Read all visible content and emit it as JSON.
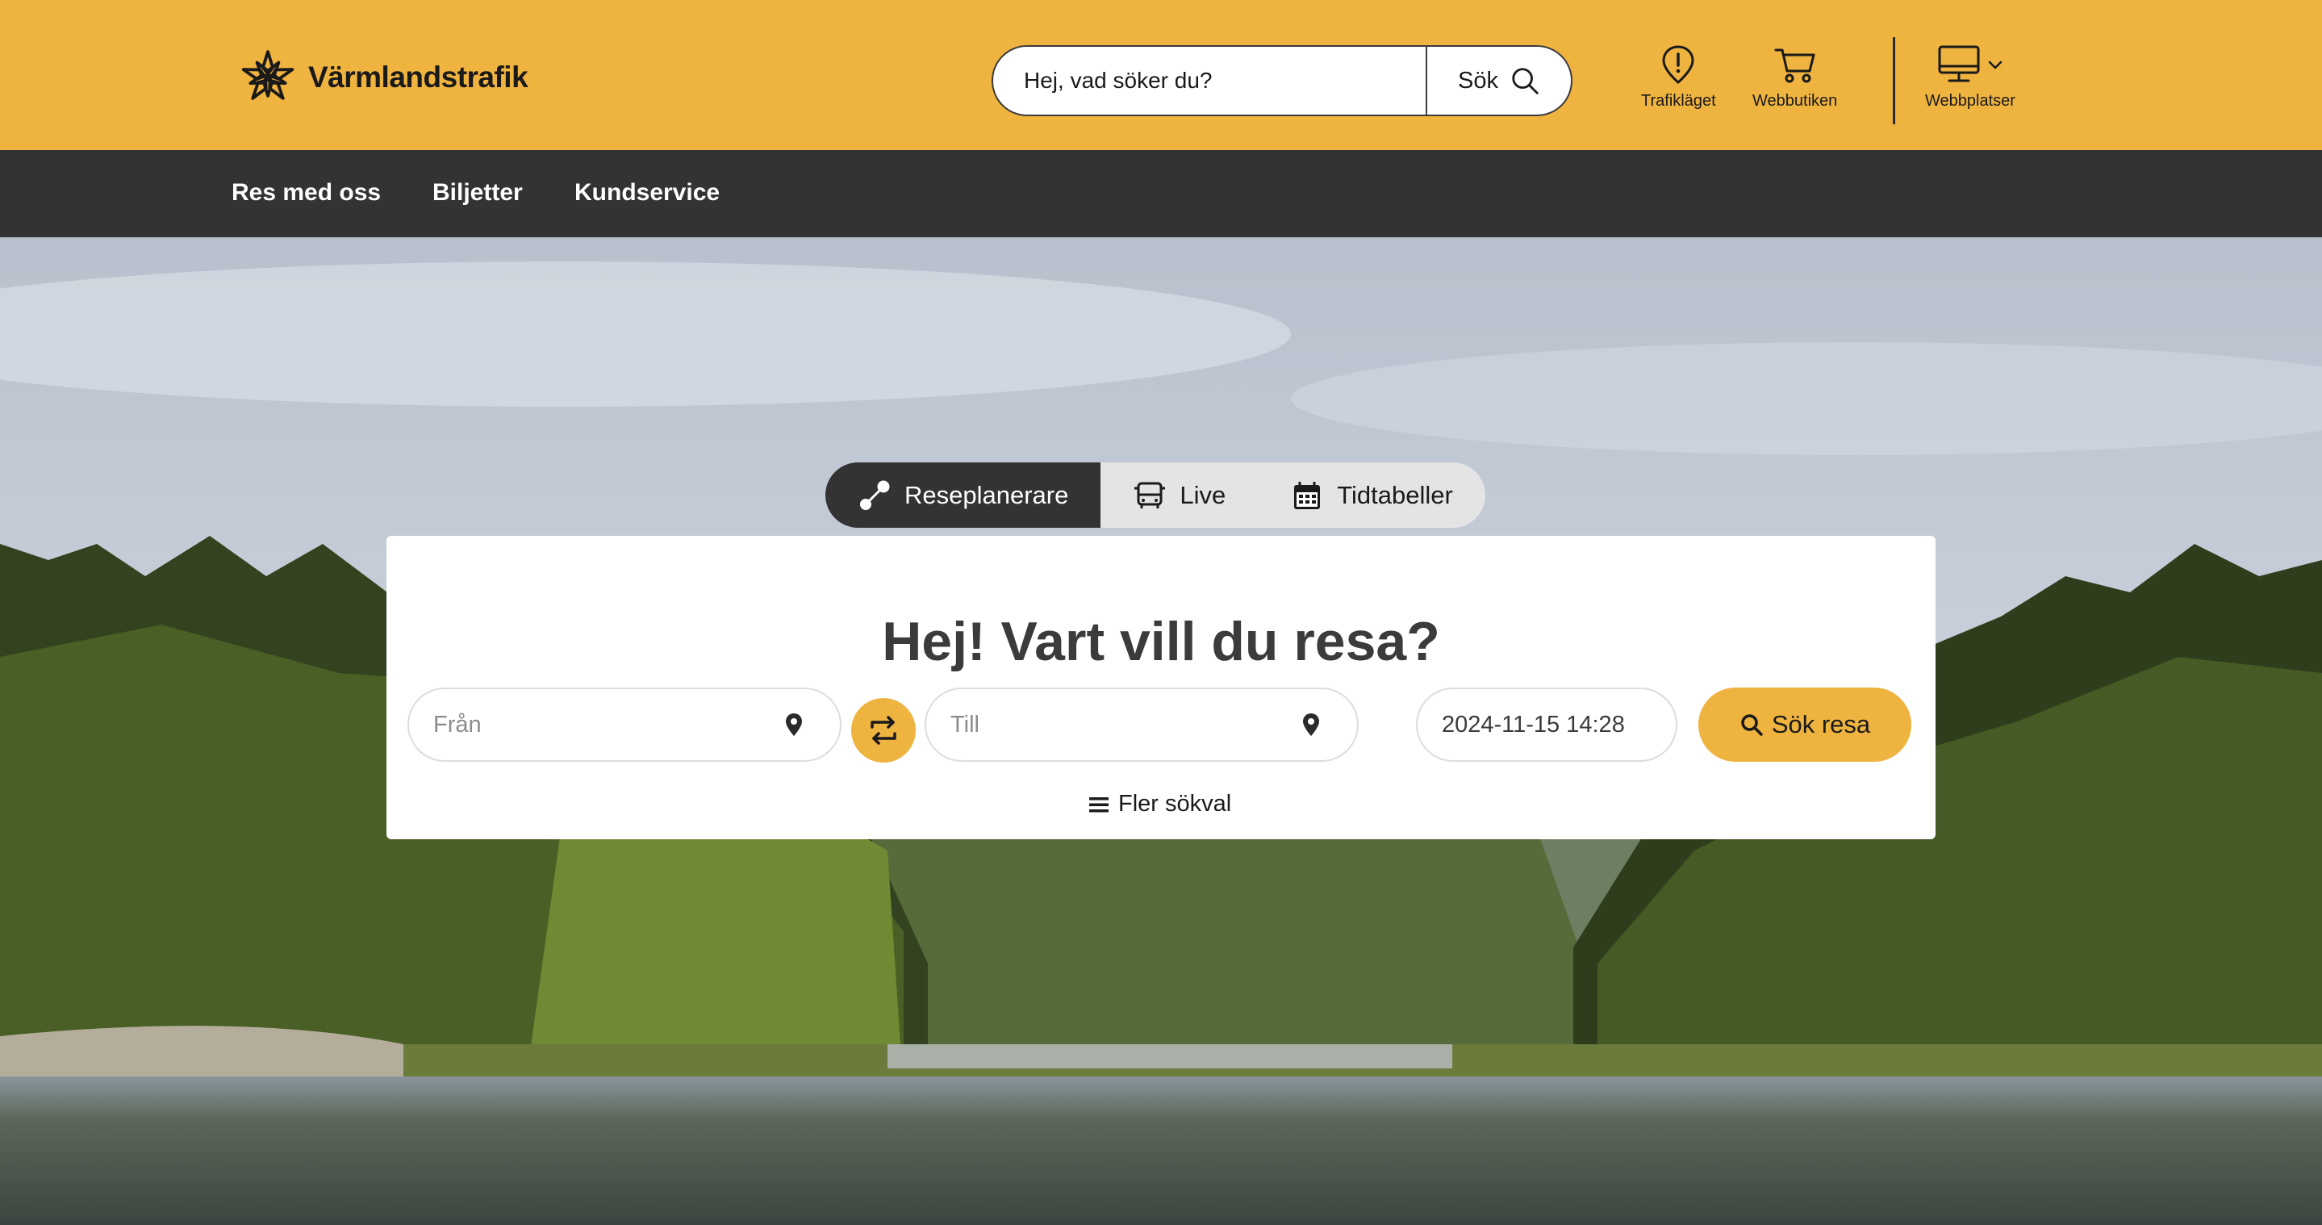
{
  "brand": {
    "name": "Värmlandstrafik"
  },
  "search": {
    "placeholder": "Hej, vad söker du?",
    "button_label": "Sök"
  },
  "quick_links": [
    {
      "label": "Trafikläget",
      "icon": "alert-pin-icon"
    },
    {
      "label": "Webbutiken",
      "icon": "cart-icon"
    },
    {
      "label": "Webbplatser",
      "icon": "monitor-icon"
    }
  ],
  "nav": {
    "items": [
      "Res med oss",
      "Biljetter",
      "Kundservice"
    ]
  },
  "tabs": [
    {
      "label": "Reseplanerare",
      "icon": "route-icon",
      "active": true
    },
    {
      "label": "Live",
      "icon": "bus-icon",
      "active": false
    },
    {
      "label": "Tidtabeller",
      "icon": "calendar-icon",
      "active": false
    }
  ],
  "planner": {
    "title": "Hej! Vart vill du resa?",
    "from_placeholder": "Från",
    "to_placeholder": "Till",
    "datetime_value": "2024-11-15 14:28",
    "search_button": "Sök resa",
    "more_options": "Fler sökval"
  },
  "colors": {
    "brand_yellow": "#efb33f",
    "nav_dark": "#333333"
  }
}
